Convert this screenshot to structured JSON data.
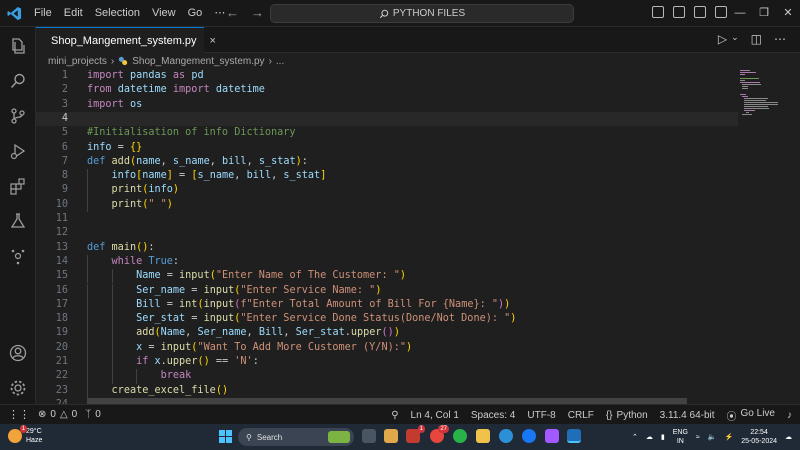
{
  "titlebar": {
    "menu": [
      "File",
      "Edit",
      "Selection",
      "View",
      "Go",
      "⋯"
    ],
    "search_text": "PYTHON FILES"
  },
  "tab": {
    "label": "Shop_Mangement_system.py",
    "close": "×"
  },
  "breadcrumb": {
    "folder": "mini_projects",
    "file": "Shop_Mangement_system.py",
    "more": "..."
  },
  "editor": {
    "current_line": 4,
    "lines": [
      "import pandas as pd",
      "from datetime import datetime",
      "import os",
      "",
      "#Initialisation of info Dictionary",
      "info = {}",
      "def add(name, s_name, bill, s_stat):",
      "    info[name] = [s_name, bill, s_stat]",
      "    print(info)",
      "    print(\" \")",
      "",
      "",
      "def main():",
      "    while True:",
      "        Name = input(\"Enter Name of The Customer: \")",
      "        Ser_name = input(\"Enter Service Name: \")",
      "        Bill = int(input(f\"Enter Total Amount of Bill For {Name}: \"))",
      "        Ser_stat = input(\"Enter Service Done Status(Done/Not Done): \")",
      "        add(Name, Ser_name, Bill, Ser_stat.upper())",
      "        x = input(\"Want To Add More Customer (Y/N):\")",
      "        if x.upper() == 'N':",
      "            break",
      "    create_excel_file()",
      ""
    ]
  },
  "statusbar": {
    "errors": "0",
    "warnings": "0",
    "ports": "0",
    "position": "Ln 4, Col 1",
    "spaces": "Spaces: 4",
    "encoding": "UTF-8",
    "eol": "CRLF",
    "language": "Python",
    "interpreter": "3.11.4 64-bit",
    "golive": "Go Live"
  },
  "taskbar": {
    "temperature": "29°C",
    "weather": "Haze",
    "weather_badge": "1",
    "search_placeholder": "Search",
    "badge_mail": "1",
    "badge_chrome": "27",
    "lang_top": "ENG",
    "lang_bottom": "IN",
    "time": "22:54",
    "date": "25-05-2024"
  },
  "colors": {
    "accent": "#0078d4",
    "editor_bg": "#1f1f1f",
    "keyword": "#c586c0",
    "function": "#dcdcaa",
    "string": "#ce9178",
    "comment": "#6a9955"
  }
}
